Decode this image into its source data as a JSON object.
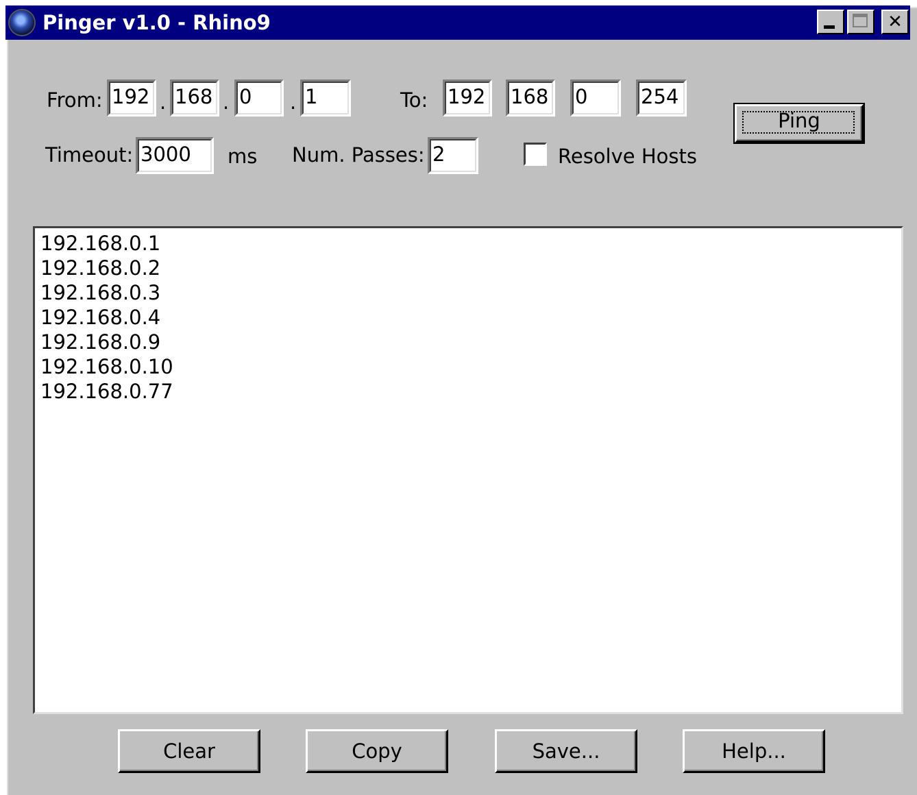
{
  "window": {
    "title": "Pinger v1.0 - Rhino9"
  },
  "range": {
    "from_label": "From:",
    "from_octets": [
      "192",
      "168",
      "0",
      "1"
    ],
    "dot": ".",
    "to_label": "To:",
    "to_octets": [
      "192",
      "168",
      "0",
      "254"
    ]
  },
  "options": {
    "timeout_label": "Timeout:",
    "timeout_value": "3000",
    "timeout_unit": "ms",
    "passes_label": "Num. Passes:",
    "passes_value": "2",
    "resolve_hosts_label": "Resolve Hosts",
    "resolve_hosts_checked": false
  },
  "buttons": {
    "ping": "Ping",
    "clear": "Clear",
    "copy": "Copy",
    "save": "Save...",
    "help": "Help..."
  },
  "results": [
    "192.168.0.1",
    "192.168.0.2",
    "192.168.0.3",
    "192.168.0.4",
    "192.168.0.9",
    "192.168.0.10",
    "192.168.0.77"
  ]
}
